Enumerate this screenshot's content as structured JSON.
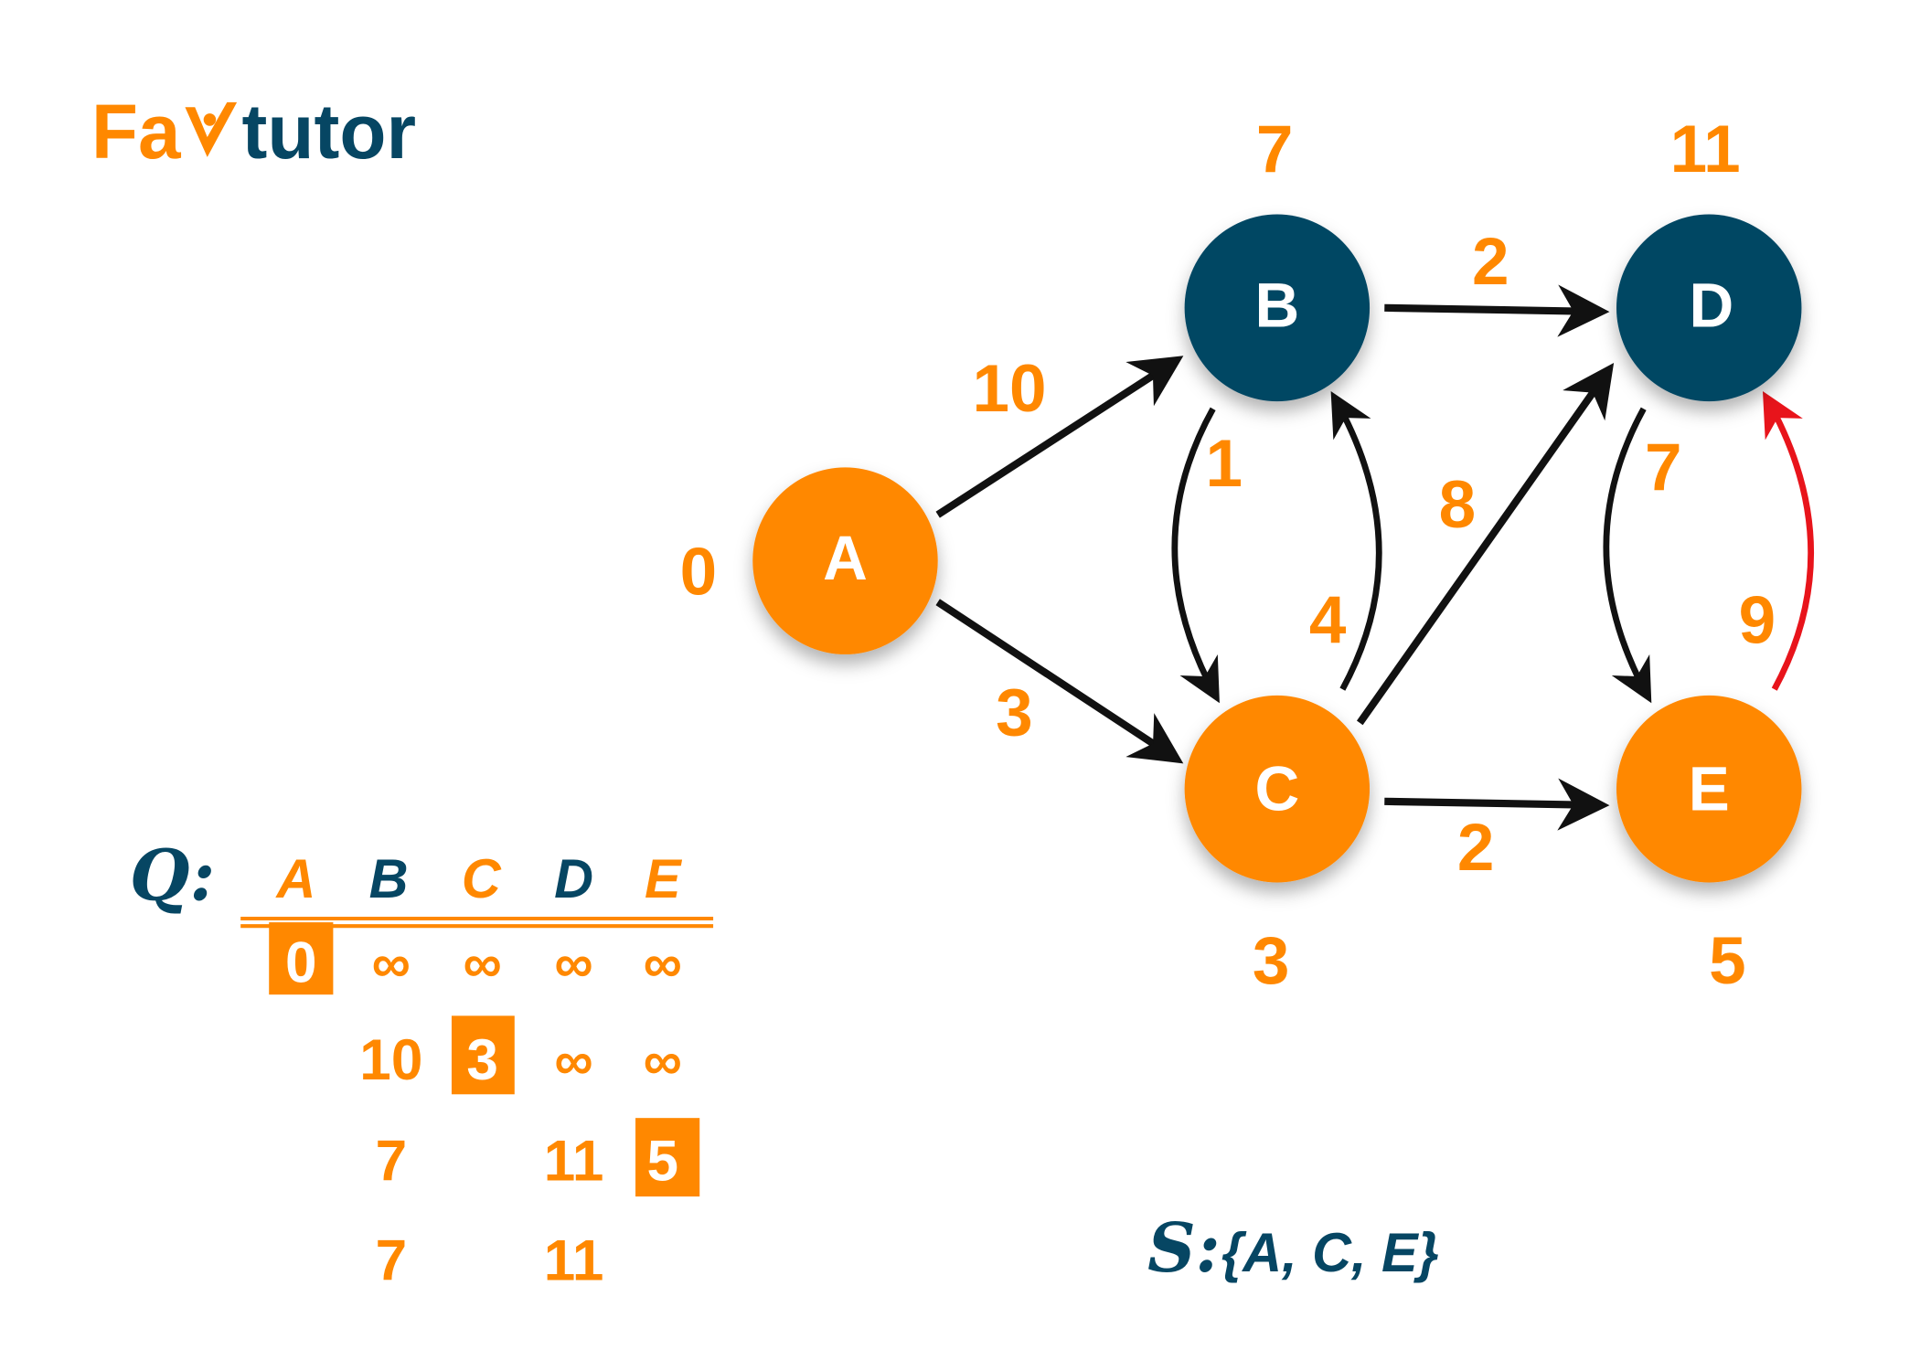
{
  "logo": {
    "part1": "Fa",
    "part2": "tutor",
    "icon": "v-checkmark-person-icon"
  },
  "colors": {
    "orange": "#FF8800",
    "dark": "#064663",
    "highlight_edge": "#E8141B",
    "edge": "#111111"
  },
  "nodes": [
    {
      "id": "A",
      "color": "orange",
      "distance": "0"
    },
    {
      "id": "B",
      "color": "dark",
      "distance": "7"
    },
    {
      "id": "C",
      "color": "orange",
      "distance": "3"
    },
    {
      "id": "D",
      "color": "dark",
      "distance": "11"
    },
    {
      "id": "E",
      "color": "orange",
      "distance": "5"
    }
  ],
  "edges": [
    {
      "from": "A",
      "to": "B",
      "weight": "10"
    },
    {
      "from": "A",
      "to": "C",
      "weight": "3"
    },
    {
      "from": "B",
      "to": "D",
      "weight": "2"
    },
    {
      "from": "B",
      "to": "C",
      "weight": "1"
    },
    {
      "from": "C",
      "to": "B",
      "weight": "4"
    },
    {
      "from": "C",
      "to": "D",
      "weight": "8"
    },
    {
      "from": "C",
      "to": "E",
      "weight": "2"
    },
    {
      "from": "D",
      "to": "E",
      "weight": "7"
    },
    {
      "from": "E",
      "to": "D",
      "weight": "9",
      "highlighted": true
    }
  ],
  "queue": {
    "label": "Q:",
    "headers": [
      "A",
      "B",
      "C",
      "D",
      "E"
    ],
    "rows": [
      [
        "0",
        "∞",
        "∞",
        "∞",
        "∞"
      ],
      [
        "",
        "10",
        "3",
        "∞",
        "∞"
      ],
      [
        "",
        "7",
        "",
        "11",
        "5"
      ],
      [
        "",
        "7",
        "",
        "11",
        ""
      ]
    ],
    "selected": [
      "0",
      "3",
      "5"
    ]
  },
  "settled": {
    "label": "S:",
    "set": "{A, C, E}"
  }
}
